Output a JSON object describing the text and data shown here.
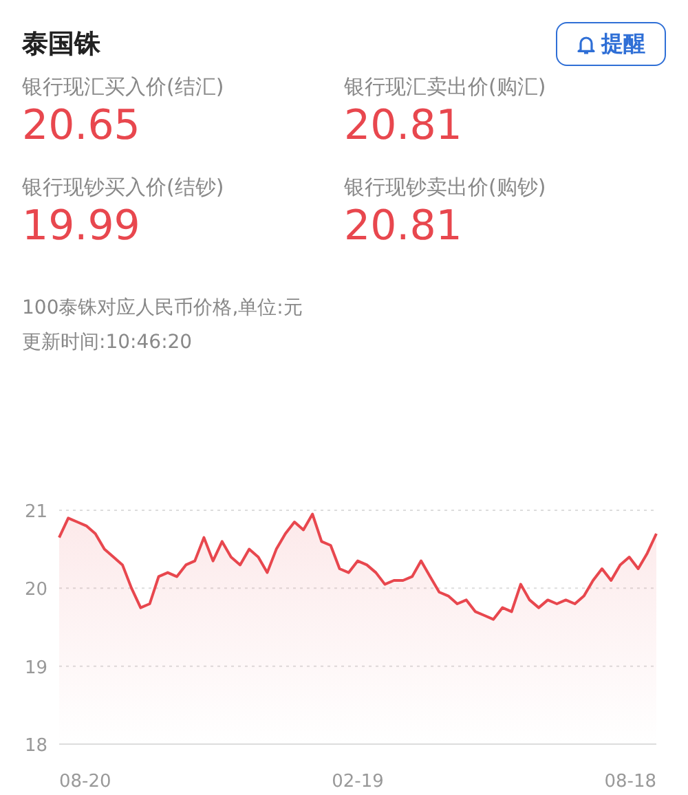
{
  "header": {
    "title": "泰国铢",
    "alert_button": "提醒"
  },
  "prices": [
    {
      "label": "银行现汇买入价(结汇)",
      "value": "20.65"
    },
    {
      "label": "银行现汇卖出价(购汇)",
      "value": "20.81"
    },
    {
      "label": "银行现钞买入价(结钞)",
      "value": "19.99"
    },
    {
      "label": "银行现钞卖出价(购钞)",
      "value": "20.81"
    }
  ],
  "note": "100泰铢对应人民币价格,单位:元",
  "updated": "更新时间:10:46:20",
  "chart": {
    "x_axis_labels": [
      "08-20",
      "02-19",
      "08-18"
    ],
    "chart_data": {
      "type": "area",
      "ylim": [
        18,
        21
      ],
      "yticks": [
        18,
        19,
        20,
        21
      ],
      "series": [
        {
          "color": "#e8474e",
          "values": [
            20.65,
            20.9,
            20.85,
            20.8,
            20.7,
            20.5,
            20.4,
            20.3,
            20.0,
            19.75,
            19.8,
            20.15,
            20.2,
            20.15,
            20.3,
            20.35,
            20.65,
            20.35,
            20.6,
            20.4,
            20.3,
            20.5,
            20.4,
            20.2,
            20.5,
            20.7,
            20.85,
            20.75,
            20.95,
            20.6,
            20.55,
            20.25,
            20.2,
            20.35,
            20.3,
            20.2,
            20.05,
            20.1,
            20.1,
            20.15,
            20.35,
            20.15,
            19.95,
            19.9,
            19.8,
            19.85,
            19.7,
            19.65,
            19.6,
            19.75,
            19.7,
            20.05,
            19.85,
            19.75,
            19.85,
            19.8,
            19.85,
            19.8,
            19.9,
            20.1,
            20.25,
            20.1,
            20.3,
            20.4,
            20.25,
            20.45,
            20.7
          ]
        }
      ]
    }
  }
}
